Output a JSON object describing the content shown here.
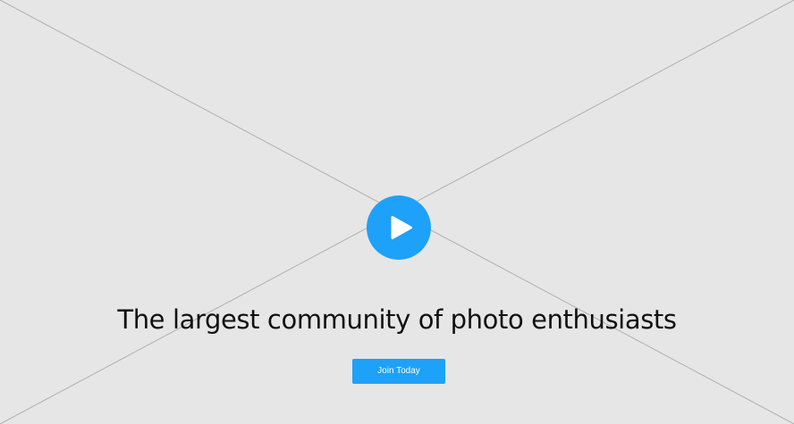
{
  "hero": {
    "play_icon": "play-icon",
    "headline": "The largest community of photo enthusiasts",
    "cta_label": "Join Today"
  },
  "colors": {
    "background": "#e6e6e6",
    "accent": "#1ea1f9",
    "headline_text": "#111111",
    "cta_text": "#ffffff",
    "placeholder_lines": "#b0b0b0"
  }
}
